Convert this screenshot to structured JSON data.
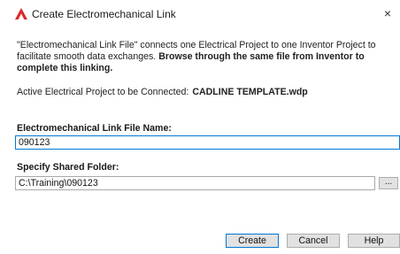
{
  "window": {
    "title": "Create Electromechanical Link",
    "app_icon": "autocad-electrical-icon",
    "close_icon": "close-icon",
    "close_glyph": "×"
  },
  "description": {
    "normal_text": "\"Electromechanical Link File\" connects one Electrical Project to one Inventor Project to facilitate smooth data exchanges.",
    "bold_text": "Browse through the same file from Inventor to complete this linking."
  },
  "active_project": {
    "label": "Active Electrical Project to be Connected:",
    "value": "CADLINE TEMPLATE.wdp"
  },
  "link_file": {
    "label": "Electromechanical Link File Name:",
    "value": "090123"
  },
  "shared_folder": {
    "label": "Specify Shared Folder:",
    "value": "C:\\Training\\090123",
    "browse_label": "..."
  },
  "buttons": {
    "create": "Create",
    "cancel": "Cancel",
    "help": "Help"
  },
  "colors": {
    "accent": "#0078d7",
    "app_icon_red": "#d92a2a"
  }
}
